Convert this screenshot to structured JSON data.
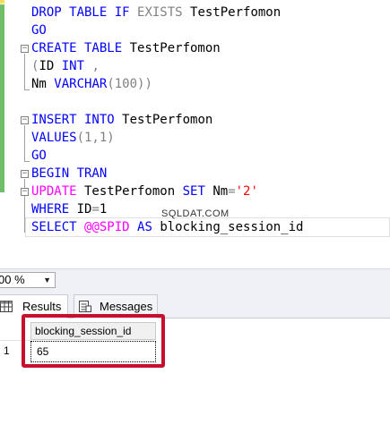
{
  "editor": {
    "lines": [
      {
        "parts": [
          {
            "t": "DROP TABLE IF ",
            "c": "kw"
          },
          {
            "t": "EXISTS",
            "c": "gr"
          },
          {
            "t": " TestPerfomon",
            "c": ""
          }
        ]
      },
      {
        "parts": [
          {
            "t": "GO",
            "c": "kw"
          }
        ]
      },
      {
        "parts": [
          {
            "t": "CREATE TABLE ",
            "c": "kw"
          },
          {
            "t": "TestPerfomon",
            "c": ""
          }
        ]
      },
      {
        "parts": [
          {
            "t": "(",
            "c": "gr"
          },
          {
            "t": "ID ",
            "c": ""
          },
          {
            "t": "INT",
            "c": "kw"
          },
          {
            "t": " ,",
            "c": "gr"
          }
        ]
      },
      {
        "parts": [
          {
            "t": "Nm ",
            "c": ""
          },
          {
            "t": "VARCHAR",
            "c": "kw"
          },
          {
            "t": "(100))",
            "c": "gr"
          }
        ]
      },
      {
        "parts": []
      },
      {
        "parts": [
          {
            "t": "INSERT INTO ",
            "c": "kw"
          },
          {
            "t": "TestPerfomon",
            "c": ""
          }
        ]
      },
      {
        "parts": [
          {
            "t": "VALUES",
            "c": "kw"
          },
          {
            "t": "(1,1)",
            "c": "gr"
          }
        ]
      },
      {
        "parts": [
          {
            "t": "GO",
            "c": "kw"
          }
        ]
      },
      {
        "parts": [
          {
            "t": "BEGIN TRAN",
            "c": "kw"
          }
        ]
      },
      {
        "parts": [
          {
            "t": "UPDATE",
            "c": "pk"
          },
          {
            "t": " TestPerfomon ",
            "c": ""
          },
          {
            "t": "SET",
            "c": "kw"
          },
          {
            "t": " Nm",
            "c": ""
          },
          {
            "t": "=",
            "c": "gr"
          },
          {
            "t": "'2'",
            "c": "str"
          }
        ]
      },
      {
        "parts": [
          {
            "t": "WHERE",
            "c": "kw"
          },
          {
            "t": " ID",
            "c": ""
          },
          {
            "t": "=",
            "c": "gr"
          },
          {
            "t": "1",
            "c": ""
          }
        ]
      },
      {
        "parts": [
          {
            "t": "SELECT ",
            "c": "kw"
          },
          {
            "t": "@@SPID",
            "c": "pk"
          },
          {
            "t": " AS ",
            "c": "kw"
          },
          {
            "t": "blocking_session_id",
            "c": ""
          }
        ]
      }
    ],
    "watermark": "SQLDAT.COM"
  },
  "zoom": {
    "value": "00 %"
  },
  "tabs": {
    "results": "Results",
    "messages": "Messages"
  },
  "results": {
    "columns": [
      "blocking_session_id"
    ],
    "rows": [
      {
        "num": "1",
        "cells": [
          "65"
        ]
      }
    ]
  },
  "colors": {
    "keyword": "#0000ff",
    "operator": "#808080",
    "function": "#ff00ff",
    "string": "#ff0000",
    "highlight": "#c8102e"
  }
}
